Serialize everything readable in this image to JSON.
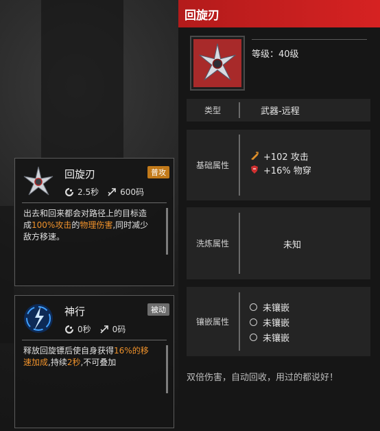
{
  "skills": [
    {
      "name": "回旋刃",
      "tag": "普攻",
      "tag_color": "#c27a1a",
      "cooldown": "2.5秒",
      "range": "600码",
      "desc_parts": [
        {
          "text": "出去和回来都会对路径上的目标造成",
          "hl": false
        },
        {
          "text": "100%攻击",
          "hl": true
        },
        {
          "text": "的",
          "hl": false
        },
        {
          "text": "物理伤害",
          "hl": true
        },
        {
          "text": ",同时减少敌方移速。",
          "hl": false
        }
      ],
      "icon": "shuriken-icon"
    },
    {
      "name": "神行",
      "tag": "被动",
      "tag_color": "#6d6d6d",
      "cooldown": "0秒",
      "range": "0码",
      "desc_parts": [
        {
          "text": "释放回旋镖后使自身获得",
          "hl": false
        },
        {
          "text": "16%的移速加成",
          "hl": true
        },
        {
          "text": ",持续",
          "hl": false
        },
        {
          "text": "2秒",
          "hl": true
        },
        {
          "text": ",不可叠加",
          "hl": false
        }
      ],
      "icon": "lightning-swirl-icon"
    }
  ],
  "item": {
    "title": "回旋刃",
    "level": "等级：40级",
    "type_label": "类型",
    "type_value": "武器-远程",
    "base_label": "基础属性",
    "base_stats": [
      {
        "text": "+102 攻击",
        "icon": "attack-icon",
        "color": "#e0902a"
      },
      {
        "text": "+16% 物穿",
        "icon": "penetration-icon",
        "color": "#d03030"
      }
    ],
    "refine_label": "洗炼属性",
    "refine_value": "未知",
    "inlay_label": "镶嵌属性",
    "sockets": [
      "未镶嵌",
      "未镶嵌",
      "未镶嵌"
    ],
    "description": "双倍伤害，自动回收，用过的都说好！",
    "accent": "#d62222"
  }
}
